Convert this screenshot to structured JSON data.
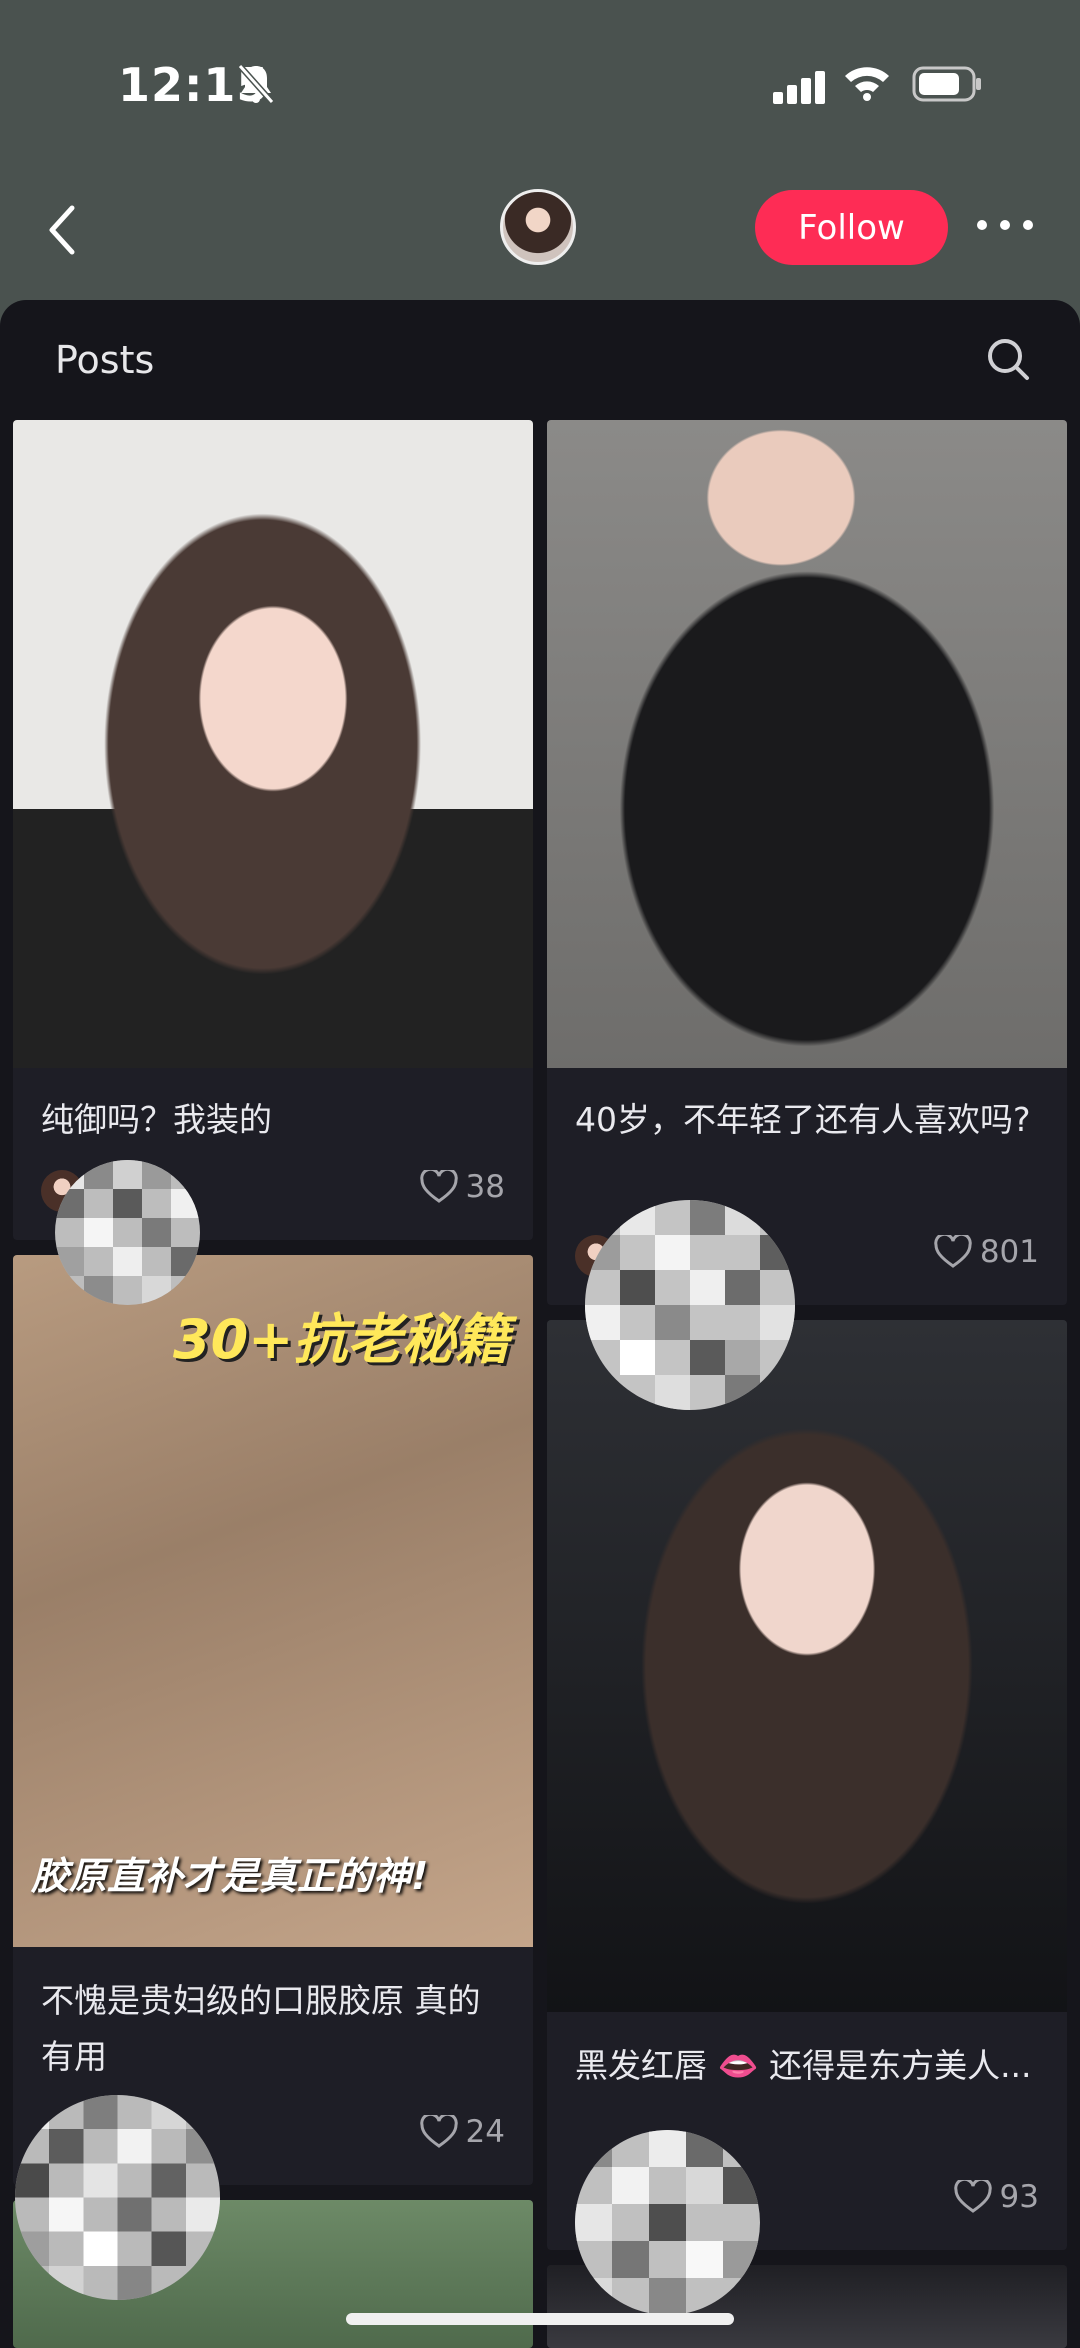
{
  "status_bar": {
    "time": "12:15"
  },
  "header": {
    "follow_label": "Follow"
  },
  "section": {
    "title": "Posts"
  },
  "posts": [
    {
      "caption": "纯御吗？我装的",
      "likes": "38"
    },
    {
      "caption": "40岁，不年轻了还有人喜欢吗?",
      "likes": "801"
    },
    {
      "caption": "不愧是贵妇级的口服胶原 真的有用",
      "likes": "24",
      "image_text_top": "30+抗老秘籍",
      "image_text_bottom": "胶原直补才是真正的神!"
    },
    {
      "caption": "黑发红唇 👄 还得是东方美人...",
      "likes": "93"
    }
  ],
  "colors": {
    "follow_button": "#fe2c55",
    "sheet_background": "#15151b",
    "header_background": "#4a524f"
  }
}
